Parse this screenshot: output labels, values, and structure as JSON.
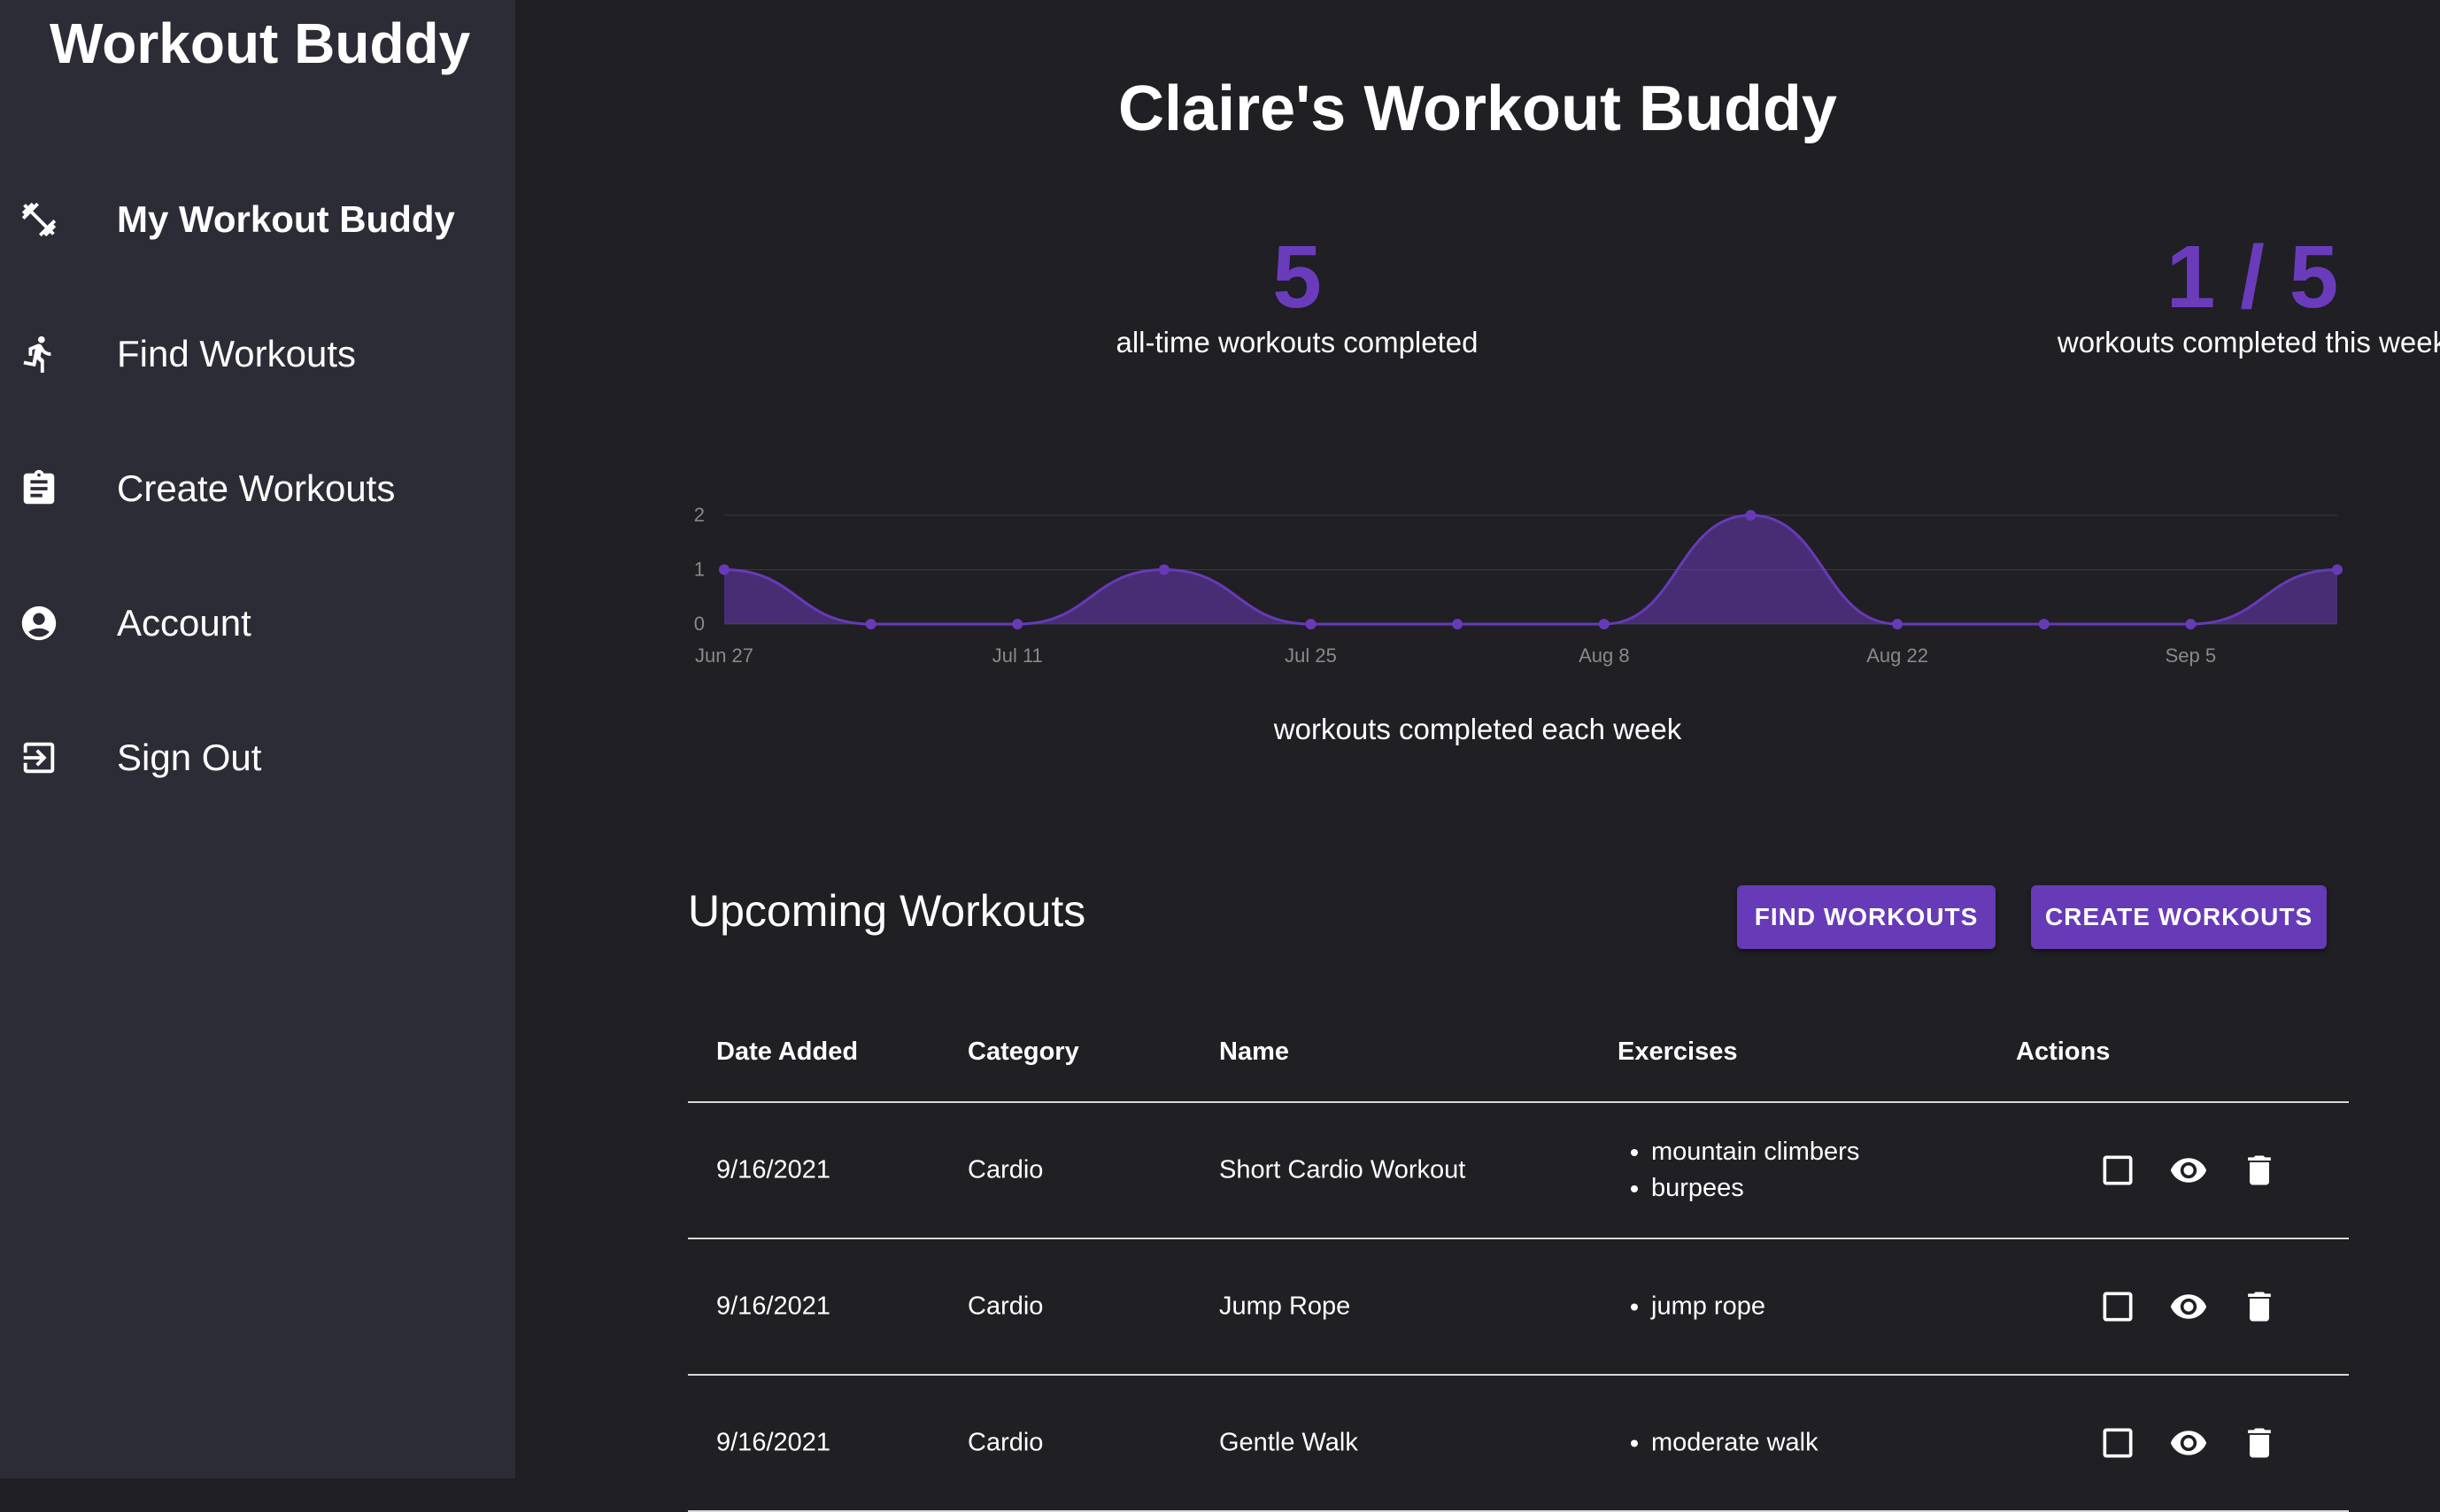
{
  "app": {
    "title": "Workout Buddy"
  },
  "sidebar": {
    "items": [
      {
        "label": "My Workout Buddy",
        "icon": "dumbbell-icon",
        "active": true
      },
      {
        "label": "Find Workouts",
        "icon": "running-icon"
      },
      {
        "label": "Create Workouts",
        "icon": "clipboard-icon"
      },
      {
        "label": "Account",
        "icon": "account-circle-icon"
      },
      {
        "label": "Sign Out",
        "icon": "sign-out-icon"
      }
    ]
  },
  "main": {
    "title": "Claire's Workout Buddy",
    "stats": [
      {
        "value": "5",
        "caption": "all-time workouts completed"
      },
      {
        "value": "1 / 5",
        "caption": "workouts completed this week"
      }
    ],
    "chart_caption": "workouts completed each week"
  },
  "chart_data": {
    "type": "area",
    "x": [
      "Jun 27",
      "Jul 4",
      "Jul 11",
      "Jul 18",
      "Jul 25",
      "Aug 1",
      "Aug 8",
      "Aug 15",
      "Aug 22",
      "Aug 29",
      "Sep 5",
      "Sep 12"
    ],
    "x_tick_labels": [
      "Jun 27",
      "Jul 11",
      "Jul 25",
      "Aug 8",
      "Aug 22",
      "Sep 5"
    ],
    "values": [
      1,
      0,
      0,
      1,
      0,
      0,
      0,
      2,
      0,
      0,
      0,
      1
    ],
    "y_tick_labels": [
      "0",
      "1",
      "2"
    ],
    "ylim": [
      0,
      2
    ],
    "color": "#673ab7",
    "title": "",
    "xlabel": "",
    "ylabel": ""
  },
  "upcoming": {
    "title": "Upcoming Workouts",
    "find_button": "FIND WORKOUTS",
    "create_button": "CREATE WORKOUTS",
    "columns": [
      "Date Added",
      "Category",
      "Name",
      "Exercises",
      "Actions"
    ],
    "rows": [
      {
        "date": "9/16/2021",
        "category": "Cardio",
        "name": "Short Cardio Workout",
        "exercises": [
          "mountain climbers",
          "burpees"
        ]
      },
      {
        "date": "9/16/2021",
        "category": "Cardio",
        "name": "Jump Rope",
        "exercises": [
          "jump rope"
        ]
      },
      {
        "date": "9/16/2021",
        "category": "Cardio",
        "name": "Gentle Walk",
        "exercises": [
          "moderate walk"
        ]
      }
    ]
  },
  "colors": {
    "accent": "#673ab7",
    "sidebar_bg": "#2c2c36",
    "main_bg": "#1f1f24"
  }
}
